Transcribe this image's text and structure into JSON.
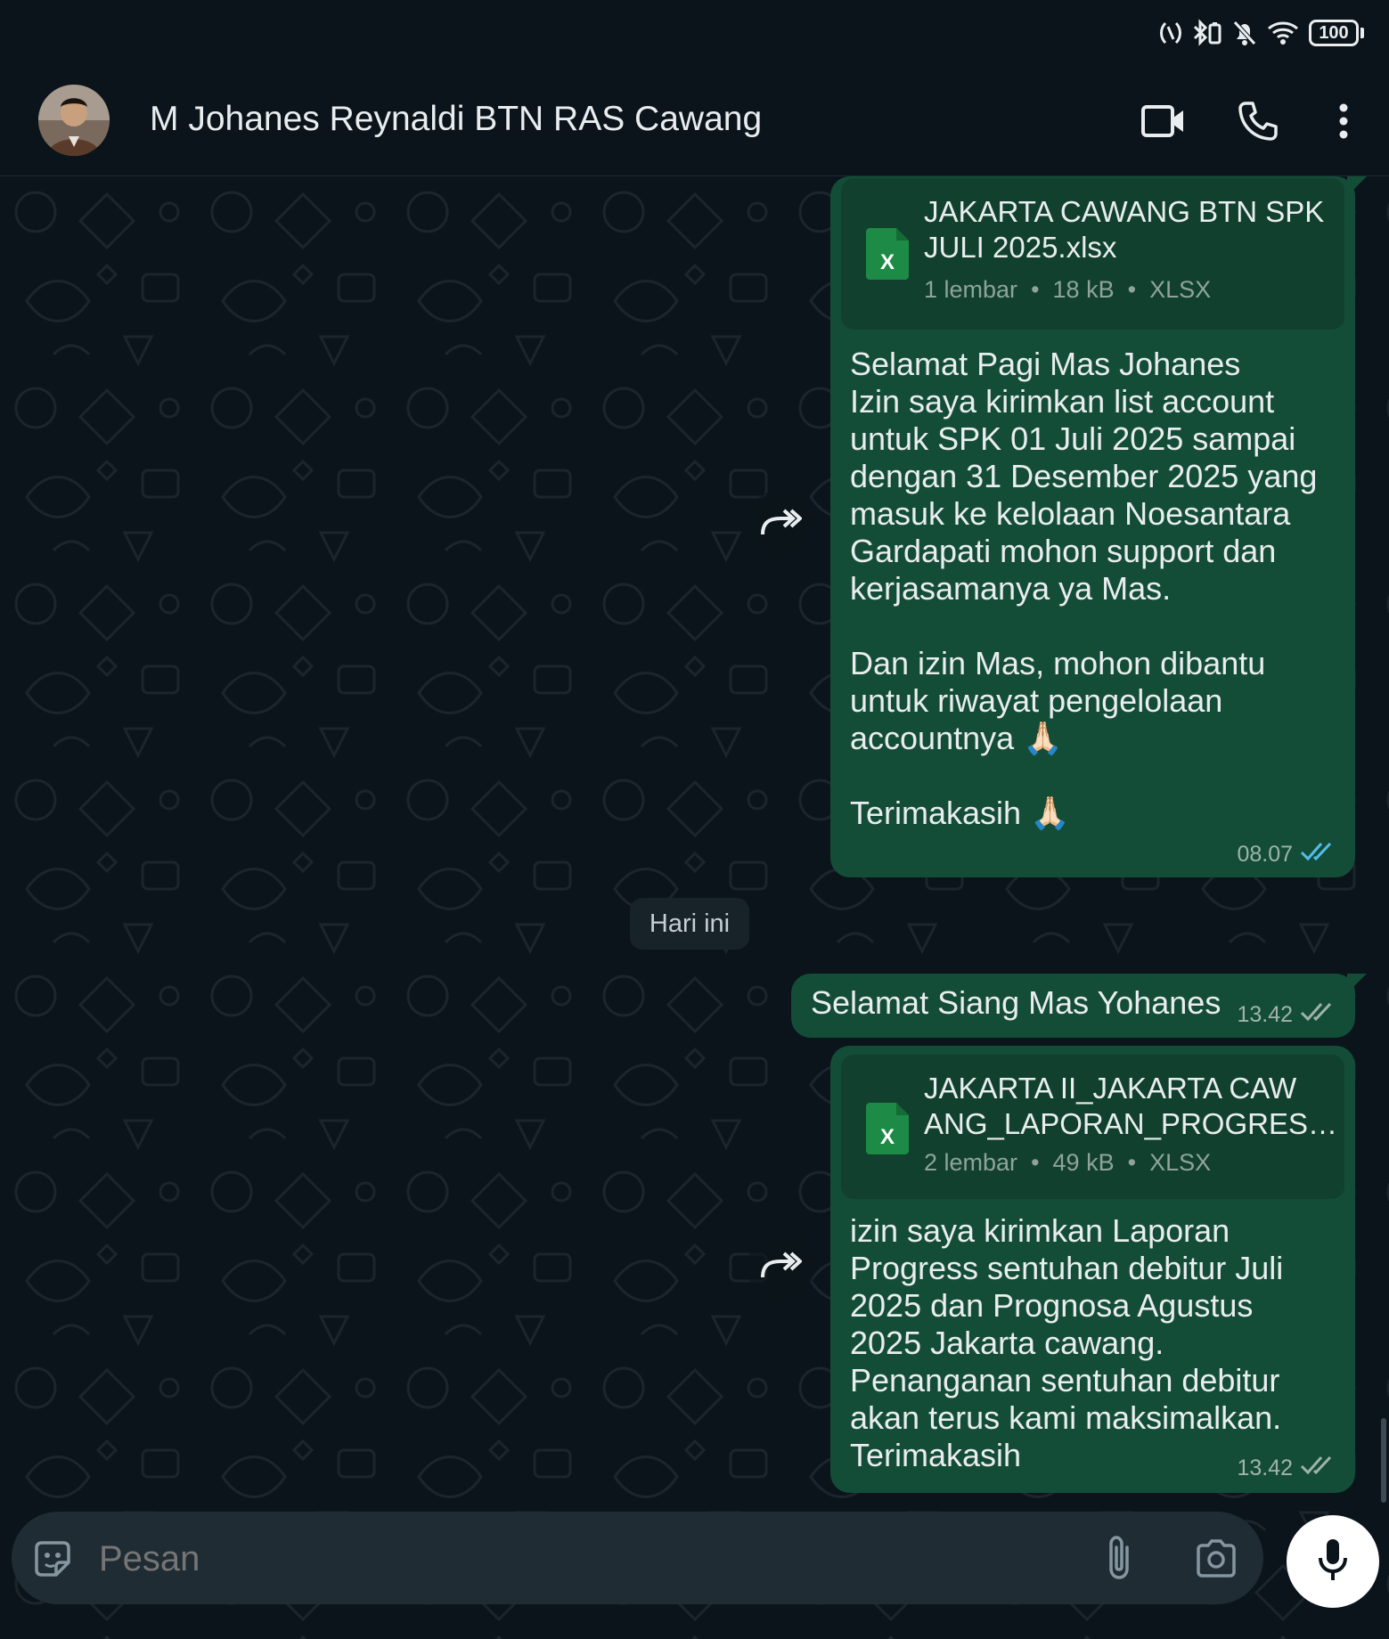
{
  "status_bar": {
    "battery": "100",
    "icons": [
      "nfc-icon",
      "bluetooth-icon",
      "mute-icon",
      "wifi-icon",
      "battery-icon"
    ]
  },
  "header": {
    "contact_name": "M Johanes Reynaldi BTN RAS Cawang",
    "actions": [
      "video-call-icon",
      "voice-call-icon",
      "more-icon"
    ]
  },
  "messages": [
    {
      "document": {
        "name": "JAKARTA CAWANG BTN SPK JULI 2025.xlsx",
        "pages": "1 lembar",
        "size": "18 kB",
        "type": "XLSX"
      },
      "text": "Selamat Pagi Mas Johanes\nIzin saya kirimkan list account untuk SPK 01 Juli 2025 sampai dengan 31 Desember 2025 yang masuk ke kelolaan Noesantara Gardapati mohon support dan kerjasamanya ya Mas.\n\nDan izin Mas, mohon dibantu untuk riwayat pengelolaan accountnya 🙏🏻\n\nTerimakasih 🙏🏻",
      "time": "08.07",
      "read": true
    },
    {
      "text": "Selamat Siang Mas Yohanes",
      "time": "13.42",
      "read": false
    },
    {
      "document": {
        "name": "JAKARTA II_JAKARTA CAW ANG_LAPORAN_PROGRES…",
        "pages": "2 lembar",
        "size": "49 kB",
        "type": "XLSX"
      },
      "text": "izin saya kirimkan Laporan Progress sentuhan debitur Juli 2025 dan Prognosa Agustus 2025 Jakarta cawang. Penanganan sentuhan debitur akan terus kami maksimalkan. Terimakasih",
      "time": "13.42",
      "read": false
    }
  ],
  "date_chip": "Hari ini",
  "input": {
    "placeholder": "Pesan"
  },
  "colors": {
    "background": "#0b141a",
    "outgoing_bubble": "#144d37",
    "read_ticks": "#53bdeb",
    "excel_green": "#1d8a45"
  },
  "separator": "•"
}
